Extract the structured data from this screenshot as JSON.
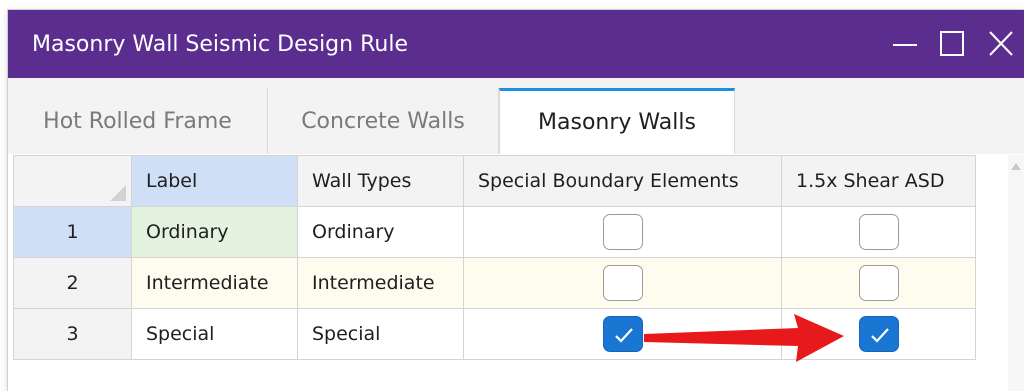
{
  "window": {
    "title": "Masonry Wall Seismic Design Rule",
    "controls": {
      "minimize": "minimize-icon",
      "maximize": "maximize-icon",
      "close": "close-icon"
    }
  },
  "tabs": [
    {
      "label": "Hot Rolled Frame",
      "active": false
    },
    {
      "label": "Concrete Walls",
      "active": false
    },
    {
      "label": "Masonry Walls",
      "active": true
    }
  ],
  "grid": {
    "columns": [
      "Label",
      "Wall Types",
      "Special Boundary Elements",
      "1.5x Shear ASD"
    ],
    "rows": [
      {
        "num": "1",
        "label": "Ordinary",
        "wall_type": "Ordinary",
        "special_boundary": false,
        "shear_asd": false
      },
      {
        "num": "2",
        "label": "Intermediate",
        "wall_type": "Intermediate",
        "special_boundary": false,
        "shear_asd": false
      },
      {
        "num": "3",
        "label": "Special",
        "wall_type": "Special",
        "special_boundary": true,
        "shear_asd": true
      }
    ]
  },
  "colors": {
    "titlebar": "#5b2d8e",
    "active_tab_accent": "#1d8fe0",
    "checkbox_checked": "#1976d2",
    "annotation_arrow": "#e8191b"
  }
}
